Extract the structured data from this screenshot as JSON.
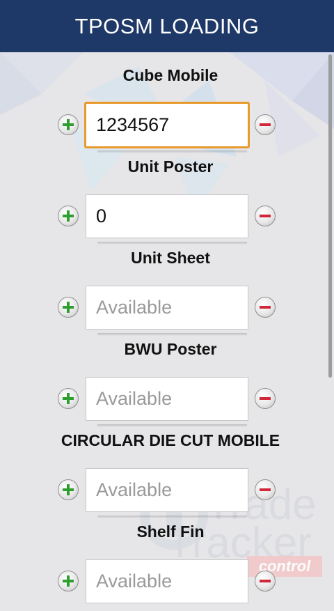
{
  "header": {
    "title": "TPOSM LOADING"
  },
  "fields": [
    {
      "label": "Cube Mobile",
      "value": "1234567",
      "placeholder": "Available"
    },
    {
      "label": "Unit Poster",
      "value": "0",
      "placeholder": "Available"
    },
    {
      "label": "Unit Sheet",
      "value": "",
      "placeholder": "Available"
    },
    {
      "label": "BWU Poster",
      "value": "",
      "placeholder": "Available"
    },
    {
      "label": "CIRCULAR DIE CUT MOBILE",
      "value": "",
      "placeholder": "Available"
    },
    {
      "label": "Shelf Fin",
      "value": "",
      "placeholder": "Available"
    }
  ],
  "watermark": {
    "line1": "Trade",
    "line2": "Tracker",
    "badge": "control"
  },
  "icons": {
    "increment": "plus-icon",
    "decrement": "minus-icon"
  },
  "colors": {
    "header": "#1e3867",
    "focus_border": "#e99a2c",
    "plus": "#2e9e2e",
    "minus": "#d0273a"
  }
}
